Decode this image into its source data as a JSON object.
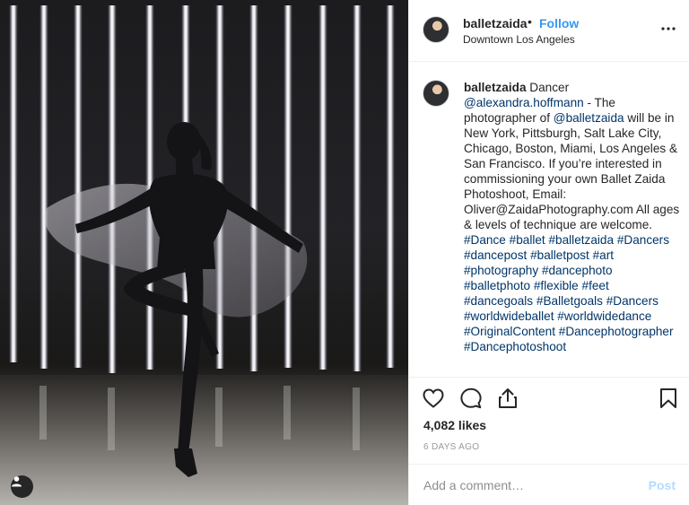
{
  "post": {
    "username": "balletzaida",
    "separator": "•",
    "follow_label": "Follow",
    "location": "Downtown Los Angeles",
    "more_icon": "ellipsis-icon"
  },
  "caption": {
    "author": "balletzaida",
    "segments": [
      {
        "t": "text",
        "v": "Dancer "
      },
      {
        "t": "link",
        "v": "@alexandra.hoffmann"
      },
      {
        "t": "text",
        "v": " - The photographer of "
      },
      {
        "t": "link",
        "v": "@balletzaida"
      },
      {
        "t": "text",
        "v": " will be in New York, Pittsburgh, Salt Lake City, Chicago, Boston, Miami, Los Angeles & San Francisco. If you’re interested in commissioning your own Ballet Zaida Photoshoot, Email: Oliver@ZaidaPhotography.com All ages & levels of technique are welcome. "
      },
      {
        "t": "link",
        "v": "#Dance"
      },
      {
        "t": "text",
        "v": " "
      },
      {
        "t": "link",
        "v": "#ballet"
      },
      {
        "t": "text",
        "v": " "
      },
      {
        "t": "link",
        "v": "#balletzaida"
      },
      {
        "t": "text",
        "v": " "
      },
      {
        "t": "link",
        "v": "#Dancers"
      },
      {
        "t": "text",
        "v": " "
      },
      {
        "t": "link",
        "v": "#dancepost"
      },
      {
        "t": "text",
        "v": " "
      },
      {
        "t": "link",
        "v": "#balletpost"
      },
      {
        "t": "text",
        "v": " "
      },
      {
        "t": "link",
        "v": "#art"
      },
      {
        "t": "text",
        "v": " "
      },
      {
        "t": "link",
        "v": "#photography"
      },
      {
        "t": "text",
        "v": " "
      },
      {
        "t": "link",
        "v": "#dancephoto"
      },
      {
        "t": "text",
        "v": " "
      },
      {
        "t": "link",
        "v": "#balletphoto"
      },
      {
        "t": "text",
        "v": " "
      },
      {
        "t": "link",
        "v": "#flexible"
      },
      {
        "t": "text",
        "v": " "
      },
      {
        "t": "link",
        "v": "#feet"
      },
      {
        "t": "text",
        "v": " "
      },
      {
        "t": "link",
        "v": "#dancegoals"
      },
      {
        "t": "text",
        "v": " "
      },
      {
        "t": "link",
        "v": "#Balletgoals"
      },
      {
        "t": "text",
        "v": " "
      },
      {
        "t": "link",
        "v": "#Dancers"
      },
      {
        "t": "text",
        "v": " "
      },
      {
        "t": "link",
        "v": "#worldwideballet"
      },
      {
        "t": "text",
        "v": " "
      },
      {
        "t": "link",
        "v": "#worldwidedance"
      },
      {
        "t": "text",
        "v": " "
      },
      {
        "t": "link",
        "v": "#OriginalContent"
      },
      {
        "t": "text",
        "v": " "
      },
      {
        "t": "link",
        "v": "#Dancephotographer"
      },
      {
        "t": "text",
        "v": " "
      },
      {
        "t": "link",
        "v": "#Dancephotoshoot"
      }
    ]
  },
  "actions": {
    "like_icon": "heart-icon",
    "comment_icon": "comment-bubble-icon",
    "share_icon": "share-icon",
    "save_icon": "bookmark-icon"
  },
  "likes_label": "4,082 likes",
  "time_label": "6 DAYS AGO",
  "comment": {
    "placeholder": "Add a comment…",
    "post_label": "Post"
  },
  "photo": {
    "user_tag_icon": "user-tag-icon"
  },
  "colors": {
    "accent": "#3897f0",
    "link": "#003569",
    "post_disabled": "#b3dbff",
    "muted": "#999999"
  }
}
